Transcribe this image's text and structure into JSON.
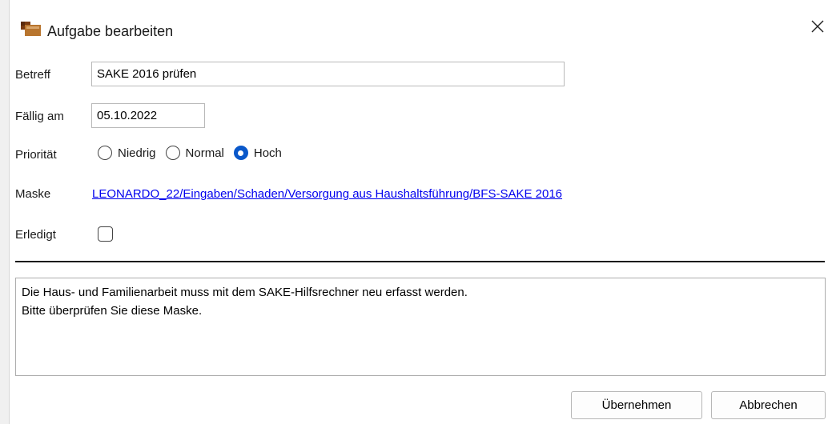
{
  "window": {
    "title": "Aufgabe bearbeiten",
    "app_icon": "folder-task-icon",
    "close_icon": "close-icon"
  },
  "form": {
    "subject_label": "Betreff",
    "subject_value": "SAKE 2016 prüfen",
    "due_label": "Fällig am",
    "due_value": "05.10.2022",
    "priority_label": "Priorität",
    "priority_options": [
      {
        "label": "Niedrig",
        "checked": false
      },
      {
        "label": "Normal",
        "checked": false
      },
      {
        "label": "Hoch",
        "checked": true
      }
    ],
    "mask_label": "Maske",
    "mask_link": "LEONARDO_22/Eingaben/Schaden/Versorgung aus Haushaltsführung/BFS-SAKE 2016",
    "done_label": "Erledigt",
    "done_checked": false
  },
  "notes": {
    "lines": [
      "Die Haus- und Familienarbeit muss mit dem SAKE-Hilfsrechner neu erfasst werden.",
      "Bitte überprüfen Sie diese Maske."
    ]
  },
  "buttons": {
    "apply_label": "Übernehmen",
    "cancel_label": "Abbrechen"
  },
  "colors": {
    "accent": "#0a58ca",
    "link": "#0000ee"
  }
}
